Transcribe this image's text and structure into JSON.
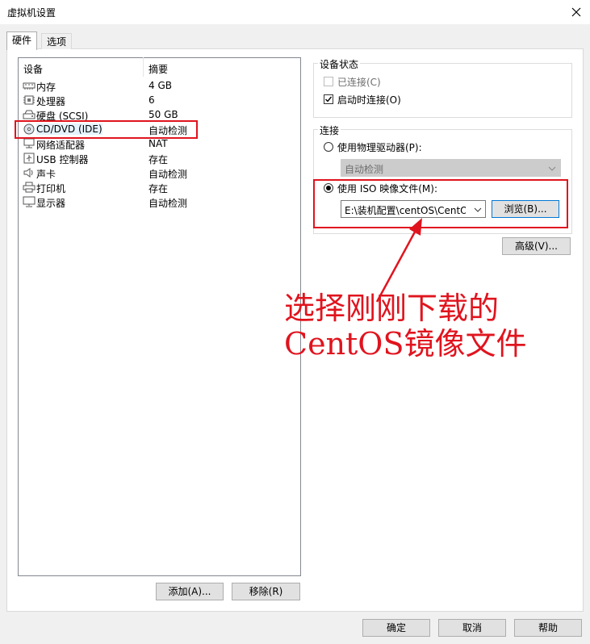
{
  "window": {
    "title": "虚拟机设置"
  },
  "tabs": [
    {
      "label": "硬件",
      "active": true
    },
    {
      "label": "选项",
      "active": false
    }
  ],
  "device_table": {
    "headers": {
      "device": "设备",
      "summary": "摘要"
    },
    "rows": [
      {
        "name": "内存",
        "summary": "4 GB",
        "icon": "memory-icon"
      },
      {
        "name": "处理器",
        "summary": "6",
        "icon": "processor-icon"
      },
      {
        "name": "硬盘 (SCSI)",
        "summary": "50 GB",
        "icon": "harddisk-icon"
      },
      {
        "name": "CD/DVD (IDE)",
        "summary": "自动检测",
        "icon": "cd-dvd-icon"
      },
      {
        "name": "网络适配器",
        "summary": "NAT",
        "icon": "network-icon"
      },
      {
        "name": "USB 控制器",
        "summary": "存在",
        "icon": "usb-icon"
      },
      {
        "name": "声卡",
        "summary": "自动检测",
        "icon": "sound-icon"
      },
      {
        "name": "打印机",
        "summary": "存在",
        "icon": "printer-icon"
      },
      {
        "name": "显示器",
        "summary": "自动检测",
        "icon": "display-icon"
      }
    ],
    "selected": "CD/DVD (IDE)"
  },
  "list_buttons": {
    "add": "添加(A)...",
    "remove": "移除(R)"
  },
  "device_status": {
    "title": "设备状态",
    "connected": {
      "label": "已连接(C)",
      "checked": false,
      "disabled": true
    },
    "connect_at_power_on": {
      "label": "启动时连接(O)",
      "checked": true
    }
  },
  "connection": {
    "title": "连接",
    "physical_drive": {
      "label": "使用物理驱动器(P):",
      "selected": false,
      "value": "自动检测"
    },
    "iso_image": {
      "label": "使用 ISO 映像文件(M):",
      "selected": true,
      "path": "E:\\装机配置\\centOS\\CentOS"
    },
    "browse_label": "浏览(B)...",
    "advanced_label": "高级(V)..."
  },
  "annotation": {
    "line1": "选择刚刚下载的",
    "line2": "CentOS镜像文件",
    "color": "#e0141e"
  },
  "footer_buttons": {
    "ok": "确定",
    "cancel": "取消",
    "help": "帮助"
  }
}
